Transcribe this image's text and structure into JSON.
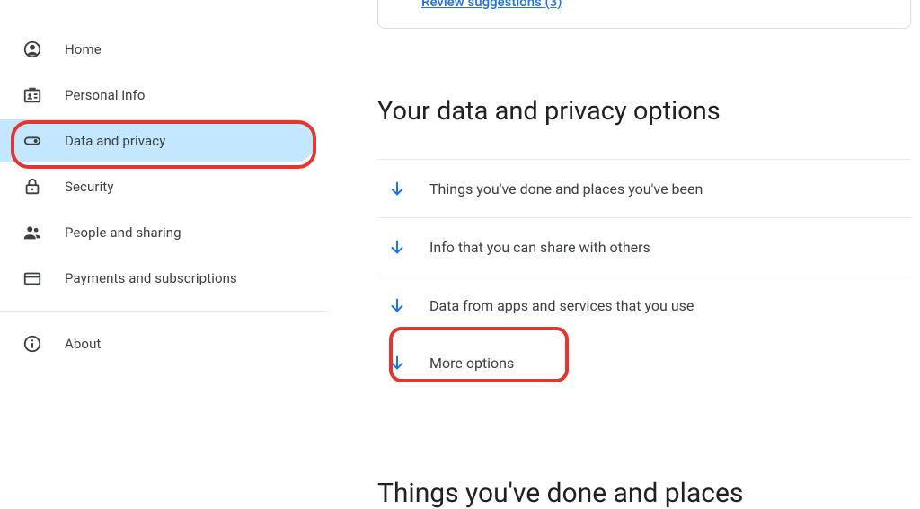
{
  "sidebar": {
    "items": [
      {
        "label": "Home"
      },
      {
        "label": "Personal info"
      },
      {
        "label": "Data and privacy"
      },
      {
        "label": "Security"
      },
      {
        "label": "People and sharing"
      },
      {
        "label": "Payments and subscriptions"
      },
      {
        "label": "About"
      }
    ]
  },
  "main": {
    "review_link": "Review suggestions (3)",
    "section_title": "Your data and privacy options",
    "options": [
      {
        "label": "Things you've done and places you've been"
      },
      {
        "label": "Info that you can share with others"
      },
      {
        "label": "Data from apps and services that you use"
      },
      {
        "label": "More options"
      }
    ],
    "next_heading": "Things you've done and places"
  }
}
